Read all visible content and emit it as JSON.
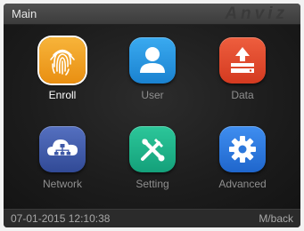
{
  "header": {
    "title": "Main",
    "brand": "Anviz"
  },
  "menu": {
    "items": [
      {
        "label": "Enroll",
        "icon": "fingerprint-icon",
        "color": "#f0a020",
        "selected": true
      },
      {
        "label": "User",
        "icon": "user-icon",
        "color": "#2196e0",
        "selected": false
      },
      {
        "label": "Data",
        "icon": "data-download-icon",
        "color": "#e04a2c",
        "selected": false
      },
      {
        "label": "Network",
        "icon": "network-cloud-icon",
        "color": "#3f59a8",
        "selected": false
      },
      {
        "label": "Setting",
        "icon": "tools-icon",
        "color": "#1fb58a",
        "selected": false
      },
      {
        "label": "Advanced",
        "icon": "gear-icon",
        "color": "#2c78dc",
        "selected": false
      }
    ]
  },
  "status": {
    "datetime": "07-01-2015 12:10:38",
    "back_hint": "M/back"
  }
}
